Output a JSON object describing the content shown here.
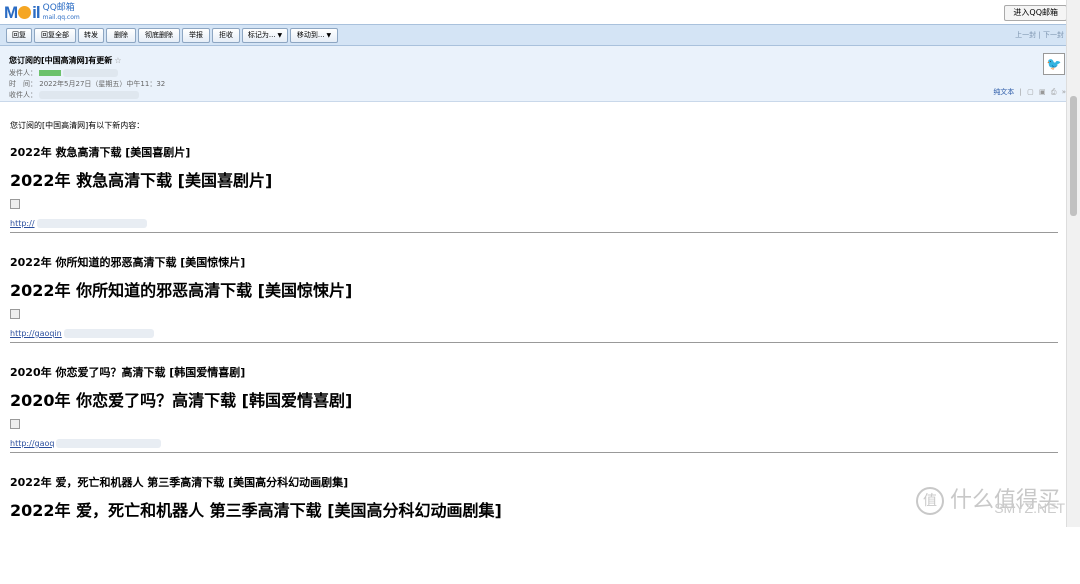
{
  "app": {
    "logo_main": "Mail",
    "logo_cn": "QQ邮箱",
    "logo_domain": "mail.qq.com",
    "enter_button": "进入QQ邮箱"
  },
  "toolbar": {
    "buttons": [
      "回复",
      "回复全部",
      "转发",
      "删除",
      "彻底删除",
      "举报",
      "拒收",
      "标记为...",
      "移动到..."
    ],
    "prev": "上一封",
    "next": "下一封"
  },
  "header": {
    "subject": "您订阅的[中国高清网]有更新",
    "star": "☆",
    "from_label": "发件人：",
    "time_label": "时　间：",
    "time_value": "2022年5月27日（星期五）中午11：32",
    "to_label": "收件人：",
    "plain_text_link": "纯文本"
  },
  "content": {
    "intro": "您订阅的[中国高清网]有以下新内容：",
    "entries": [
      {
        "small_title": "2022年 救急高清下载 [美国喜剧片]",
        "big_title": "2022年 救急高清下载 [美国喜剧片]",
        "link": "http://"
      },
      {
        "small_title": "2022年 你所知道的邪恶高清下载 [美国惊悚片]",
        "big_title": "2022年 你所知道的邪恶高清下载 [美国惊悚片]",
        "link": "http://gaoqin"
      },
      {
        "small_title": "2020年 你恋爱了吗？高清下载 [韩国爱情喜剧]",
        "big_title": "2020年 你恋爱了吗？高清下载 [韩国爱情喜剧]",
        "link": "http://gaoq"
      },
      {
        "small_title": "2022年 爱，死亡和机器人 第三季高清下载 [美国高分科幻动画剧集]",
        "big_title": "2022年 爱，死亡和机器人 第三季高清下载 [美国高分科幻动画剧集]",
        "link": ""
      }
    ]
  },
  "watermark": {
    "text": "什么值得买",
    "sub": "SMYZ.NET"
  }
}
